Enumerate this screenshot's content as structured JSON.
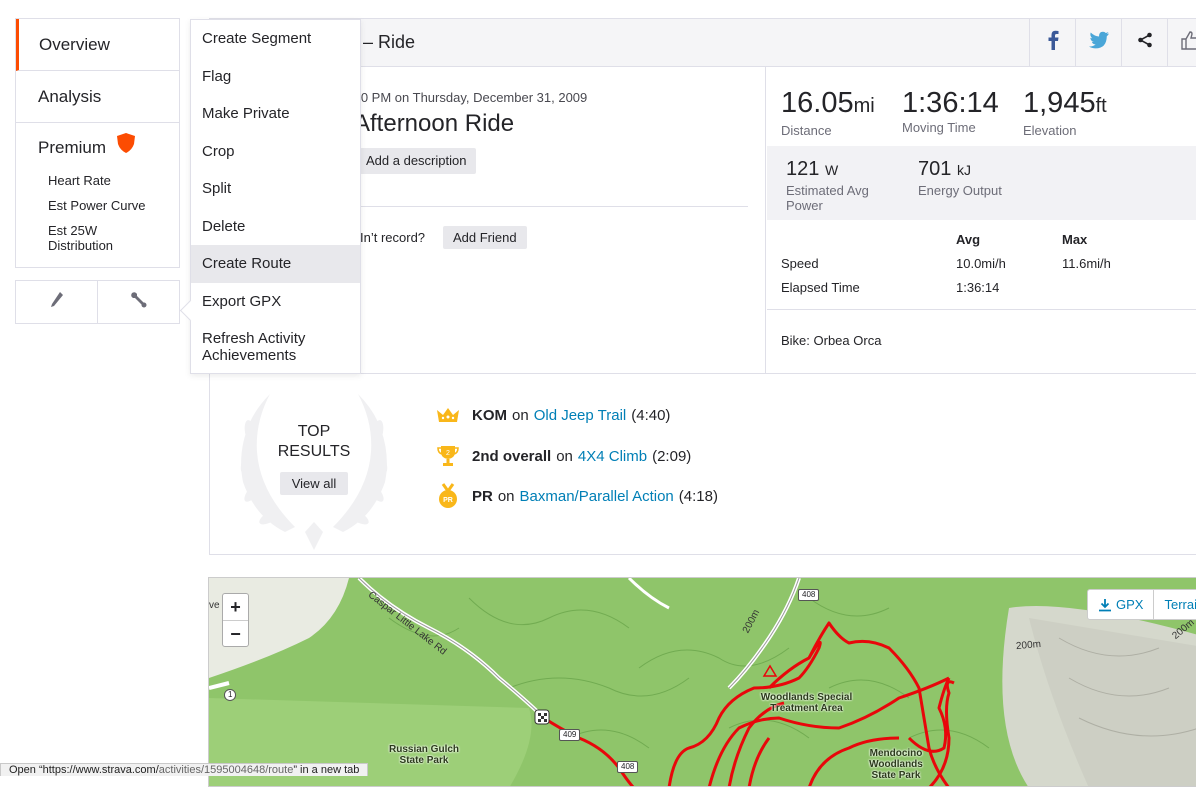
{
  "sidebar": {
    "items": [
      {
        "label": "Overview",
        "active": true
      },
      {
        "label": "Analysis"
      }
    ],
    "premium": {
      "label": "Premium",
      "sub_items": [
        "Heart Rate",
        "Est Power Curve",
        "Est 25W Distribution"
      ]
    },
    "tools": [
      "pencil-icon",
      "wrench-icon"
    ]
  },
  "header": {
    "title": "– Ride",
    "share_icons": [
      "facebook-icon",
      "twitter-icon",
      "share-icon",
      "thumbs-up-icon"
    ]
  },
  "activity": {
    "date": ":00 PM on Thursday, December 31, 2009",
    "title": "Afternoon Ride",
    "add_description": "Add a description",
    "friend_prompt": "In’t record?",
    "add_friend": "Add Friend"
  },
  "stats": {
    "distance": {
      "value": "16.05",
      "unit": "mi",
      "label": "Distance"
    },
    "moving_time": {
      "value": "1:36:14",
      "label": "Moving Time"
    },
    "elevation": {
      "value": "1,945",
      "unit": "ft",
      "label": "Elevation"
    },
    "power": {
      "value": "121",
      "unit": "W",
      "label": "Estimated Avg Power"
    },
    "energy": {
      "value": "701",
      "unit": "kJ",
      "label": "Energy Output"
    },
    "table": {
      "avg_label": "Avg",
      "max_label": "Max",
      "rows": [
        {
          "label": "Speed",
          "avg": "10.0mi/h",
          "max": "11.6mi/h"
        },
        {
          "label": "Elapsed Time",
          "avg": "1:36:14",
          "max": ""
        }
      ]
    },
    "bike": "Bike: Orbea Orca"
  },
  "menu": {
    "items": [
      "Create Segment",
      "Flag",
      "Make Private",
      "Crop",
      "Split",
      "Delete",
      "Create Route",
      "Export GPX",
      "Refresh Activity Achievements"
    ],
    "hovered": "Create Route"
  },
  "results": {
    "top_label": "TOP RESULTS",
    "view_all": "View all",
    "rows": [
      {
        "badge": "KOM",
        "text": "on",
        "segment": "Old Jeep Trail",
        "time": "(4:40)",
        "icon": "crown-icon"
      },
      {
        "badge": "2nd overall",
        "text": "on",
        "segment": "4X4 Climb",
        "time": "(2:09)",
        "icon": "trophy-icon"
      },
      {
        "badge": "PR",
        "text": "on",
        "segment": "Baxman/Parallel Action",
        "time": "(4:18)",
        "icon": "pr-medal-icon"
      }
    ]
  },
  "map": {
    "zoom_in": "+",
    "zoom_out": "−",
    "gpx": "GPX",
    "terrain": "Terrai",
    "labels": {
      "road1": "Caspar Little Lake Rd",
      "woodlands": "Woodlands Special Treatment Area",
      "mendocino": "Mendocino Woodlands State Park",
      "russian": "Russian Gulch State Park",
      "contour1": "200m",
      "contour2": "200m",
      "contour3": "200m",
      "route408": "408",
      "route1": "1",
      "route409": "409",
      "route408b": "408",
      "edge": "ve"
    },
    "colors": {
      "route": "#e8070b",
      "forest": "#8fc56a",
      "forest_dark": "#6aa54b"
    }
  },
  "statusbar": {
    "text_a": "Open “https://www.strava.com/",
    "text_b": "activities/1595004648/route",
    "text_c": "” in a new tab"
  },
  "colors": {
    "accent": "#fc4c02",
    "link": "#007fb6"
  }
}
